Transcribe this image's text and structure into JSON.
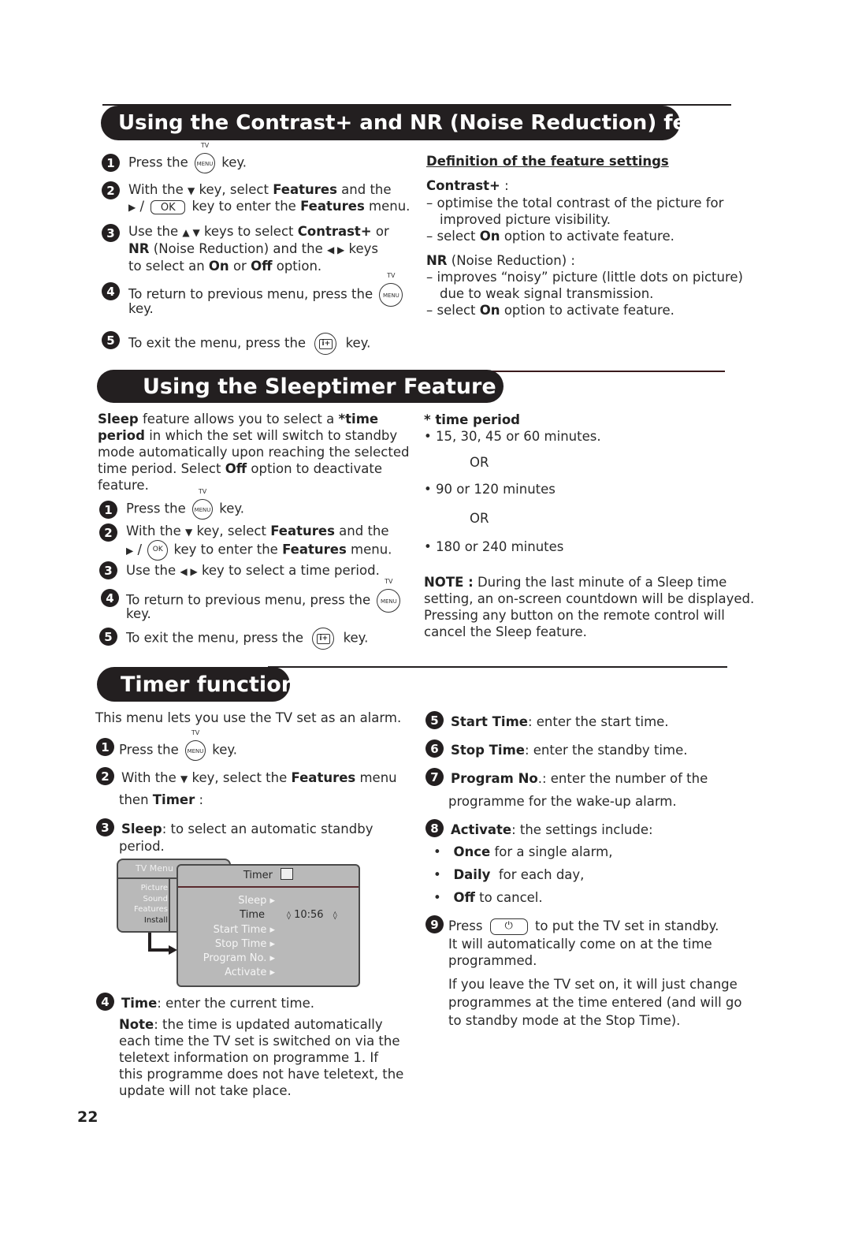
{
  "page_number": "22",
  "section1": {
    "title": "Using the Contrast+ and NR (Noise Reduction) features",
    "steps": [
      {
        "n": "1",
        "pre": "Press the",
        "key": "MENU",
        "key_top": "TV",
        "post": "key."
      },
      {
        "n": "2",
        "l1_pre": "With the",
        "l1_arrow": "▼",
        "l1_mid": "key, select",
        "l1_bold": "Features",
        "l1_post": "and the",
        "l2_arrow": "▶",
        "l2_sep": "/",
        "l2_key": "OK",
        "l2_mid": "key to enter the",
        "l2_bold": "Features",
        "l2_post": "menu."
      },
      {
        "n": "3",
        "l1_pre": "Use the",
        "l1_arrows": "▲ ▼",
        "l1_mid": "keys to select",
        "l1_bold": "Contrast+",
        "l1_post": "or",
        "l2_bold": "NR",
        "l2_mid": "(Noise Reduction) and the",
        "l2_arrows": "◀  ▶",
        "l2_post": "keys",
        "l3_pre": "to select an",
        "l3_bold1": "On",
        "l3_mid": "or",
        "l3_bold2": "Off",
        "l3_post": "option."
      },
      {
        "n": "4",
        "l1": "To return to previous menu, press the",
        "key": "MENU",
        "key_top": "TV",
        "l2": "key."
      },
      {
        "n": "5",
        "pre": "To exit the menu, press the",
        "key": "i+",
        "post": "key."
      }
    ],
    "definition": {
      "heading": "Definition of the feature settings",
      "contrast_label": "Contrast+",
      "contrast_colon": " :",
      "contrast_items": [
        "– optimise the total contrast of the picture for",
        "improved picture visibility."
      ],
      "contrast_select": {
        "pre": "– select",
        "bold": "On",
        "post": "option to activate feature."
      },
      "nr_label": "NR",
      "nr_rest": "(Noise Reduction) :",
      "nr_items": [
        "– improves “noisy” picture (little dots on picture)",
        "due to weak signal transmission."
      ],
      "nr_select": {
        "pre": "– select",
        "bold": "On",
        "post": "option to activate feature."
      }
    }
  },
  "section2": {
    "title": "Using the Sleeptimer Feature",
    "intro": {
      "l1_bold": "Sleep",
      "l1_mid": "feature allows you to select a",
      "l1_bold2": "*time",
      "l2_bold": "period",
      "l2_post": "in which the set will switch to standby",
      "l3": "mode automatically upon reaching the selected",
      "l4_pre": "time period. Select",
      "l4_bold": "Off",
      "l4_post": "option to deactivate",
      "l5": "feature."
    },
    "steps": [
      {
        "n": "1",
        "pre": "Press the",
        "key": "MENU",
        "key_top": "TV",
        "post": "key."
      },
      {
        "n": "2",
        "l1_pre": "With the",
        "l1_arrow": "▼",
        "l1_mid": "key, select",
        "l1_bold": "Features",
        "l1_post": "and the",
        "l2_arrow": "▶",
        "l2_sep": "/",
        "l2_key": "OK",
        "l2_mid": "key to enter the",
        "l2_bold": "Features",
        "l2_post": "menu."
      },
      {
        "n": "3",
        "pre": "Use the",
        "arrows": "◀  ▶",
        "post": "key to select a time period."
      },
      {
        "n": "4",
        "l1": "To return to previous menu, press the",
        "key": "MENU",
        "key_top": "TV",
        "l2": "key."
      },
      {
        "n": "5",
        "pre": "To exit the menu, press the",
        "key": "i+",
        "post": "key."
      }
    ],
    "time_period": {
      "heading": "* time period",
      "options": [
        "• 15, 30, 45 or 60 minutes.",
        "• 90 or 120 minutes",
        "• 180 or 240 minutes"
      ],
      "or": "OR"
    },
    "note": {
      "label": "NOTE :",
      "lines": [
        "During the last minute of a Sleep time",
        "setting, an on-screen countdown will be displayed.",
        "Pressing any button on the remote control will",
        "cancel the Sleep feature."
      ]
    }
  },
  "section3": {
    "title": "Timer function",
    "intro": "This menu lets you use the TV set as an alarm.",
    "steps_left": [
      {
        "n": "1",
        "pre": "Press the",
        "key": "MENU",
        "key_top": "TV",
        "post": "key."
      },
      {
        "n": "2",
        "l1_pre": "With the",
        "l1_arrow": "▼",
        "l1_mid": "key, select the",
        "l1_bold": "Features",
        "l1_post": "menu",
        "l2_pre": "then",
        "l2_bold": "Timer",
        "l2_post": " :"
      },
      {
        "n": "3",
        "bold": "Sleep",
        "rest": ": to select an automatic standby",
        "l2": "period."
      },
      {
        "n": "4",
        "bold": "Time",
        "rest": ": enter the current time."
      }
    ],
    "time_note": {
      "bold": "Note",
      "l1": ": the time is updated automatically",
      "lines": [
        "each time the TV set is switched on via the",
        "teletext information on programme 1. If",
        "this programme does not have teletext, the",
        "update will not take place."
      ]
    },
    "menu_screen": {
      "tv_menu_title": "TV Menu",
      "tv_menu_items": [
        "Picture",
        "Sound",
        "Features",
        "Install"
      ],
      "timer_title": "Timer",
      "timer_items": [
        "Sleep ▸",
        "Time",
        "Start Time ▸",
        "Stop Time ▸",
        "Program No. ▸",
        "Activate ▸"
      ],
      "time_value": "10:56"
    },
    "steps_right": [
      {
        "n": "5",
        "bold": "Start Time",
        "rest": ": enter the start time."
      },
      {
        "n": "6",
        "bold": "Stop Time",
        "rest": ": enter the standby time."
      },
      {
        "n": "7",
        "bold": "Program No",
        "rest": ".: enter the number of the",
        "l2": "programme for the wake-up alarm."
      },
      {
        "n": "8",
        "bold": "Activate",
        "rest": ": the settings include:"
      }
    ],
    "activate_options": [
      {
        "bold": "Once",
        "rest": " for a single alarm,"
      },
      {
        "bold": "Daily",
        "rest": "  for each day,"
      },
      {
        "bold": "Off",
        "rest": " to cancel."
      }
    ],
    "step9": {
      "n": "9",
      "pre": "Press",
      "key": "⏻",
      "post": "to put the TV set in standby.",
      "lines": [
        "It will automatically come on at the time",
        "programmed."
      ],
      "para": [
        "If you leave the TV set on, it will just change",
        "programmes at the time entered (and will go",
        "to standby mode at the Stop Time)."
      ]
    }
  }
}
